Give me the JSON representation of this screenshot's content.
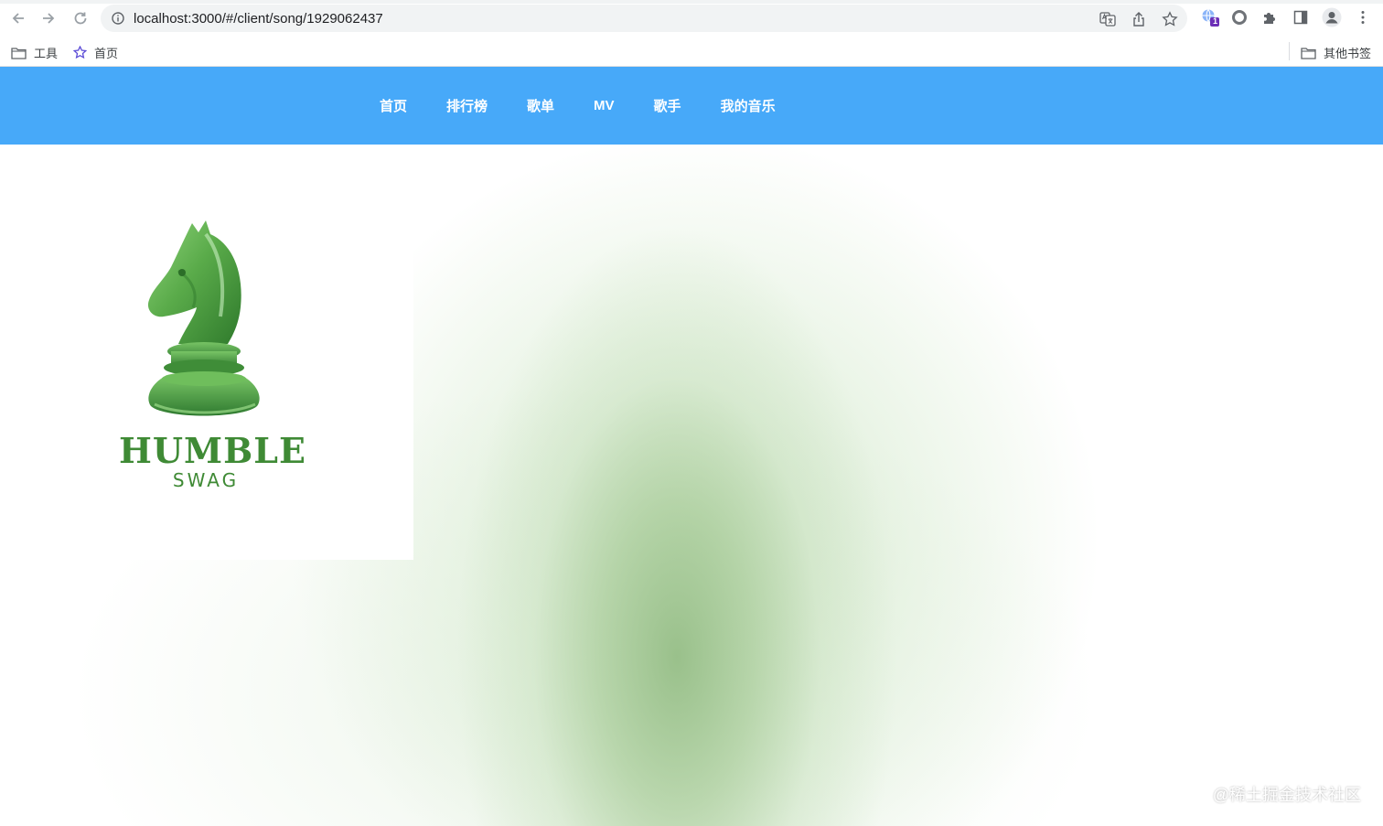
{
  "browser": {
    "url": "localhost:3000/#/client/song/1929062437",
    "extension_badge": "1"
  },
  "bookmarks": {
    "items": [
      {
        "label": "工具",
        "icon": "folder-icon"
      },
      {
        "label": "首页",
        "icon": "star-icon"
      }
    ],
    "other": {
      "label": "其他书签",
      "icon": "folder-icon"
    }
  },
  "nav": {
    "items": [
      {
        "label": "首页"
      },
      {
        "label": "排行榜"
      },
      {
        "label": "歌单"
      },
      {
        "label": "MV"
      },
      {
        "label": "歌手"
      },
      {
        "label": "我的音乐"
      }
    ]
  },
  "cover": {
    "brand_main": "HUMBLE",
    "brand_sub": "SWAG"
  },
  "watermark": "@稀土掘金技术社区",
  "colors": {
    "header": "#47a9f9",
    "brand": "#3f8a35"
  }
}
